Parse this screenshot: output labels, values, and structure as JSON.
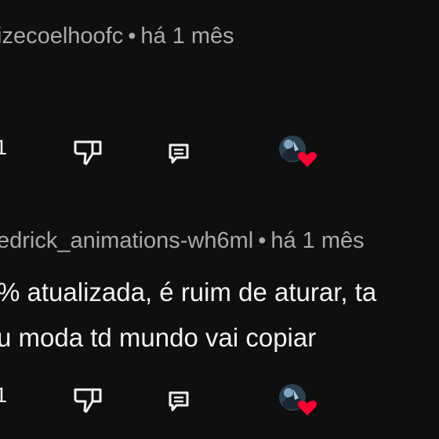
{
  "comments": [
    {
      "author": "izecoelhoofc",
      "separator": "•",
      "time": "há 1 mês",
      "like_count": "1",
      "text_lines": []
    },
    {
      "author": "edrick_animations-wh6ml",
      "separator": "•",
      "time": "há 1 mês",
      "like_count": "1",
      "text_lines": [
        "% atualizada, é ruim de aturar, ta",
        "u moda td mundo vai copiar"
      ]
    }
  ],
  "icons": {
    "dislike": "thumbs-down-icon",
    "reply": "reply-comment-icon",
    "creator_heart": "creator-heart-icon"
  },
  "colors": {
    "background": "#0f0f0f",
    "text": "#f1f1f1",
    "meta": "#aaaaaa",
    "heart": "#ff0033"
  }
}
